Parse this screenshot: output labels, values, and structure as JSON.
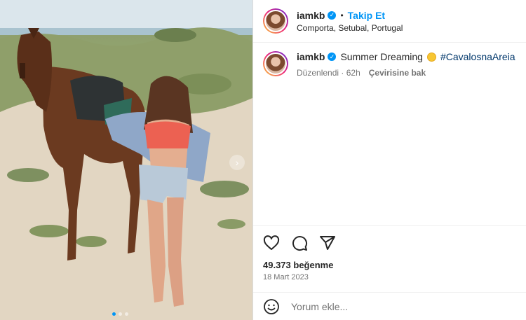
{
  "post": {
    "author": {
      "username": "iamkb",
      "verified_icon": "verified-badge-icon",
      "follow_label": "Takip Et",
      "separator": "•",
      "location": "Comporta, Setubal, Portugal"
    },
    "caption": {
      "username": "iamkb",
      "text": "Summer Dreaming",
      "emoji": "sun-emoji-icon",
      "hashtag": "#CavalosnaAreia",
      "edited_label": "Düzenlendi",
      "age": "62h",
      "translate_label": "Çevirisine bak"
    },
    "actions": {
      "icons": [
        "heart-icon",
        "comment-icon",
        "share-icon"
      ]
    },
    "likes_text": "49.373 beğenme",
    "date_text": "18 Mart 2023",
    "comment": {
      "placeholder": "Yorum ekle...",
      "icon": "emoji-icon"
    },
    "carousel": {
      "next_icon": "chevron-right-icon",
      "slide_count": 3,
      "active_slide": 1
    }
  },
  "colors": {
    "accent": "#0095f6",
    "hashtag": "#00376b",
    "muted": "#737373"
  }
}
